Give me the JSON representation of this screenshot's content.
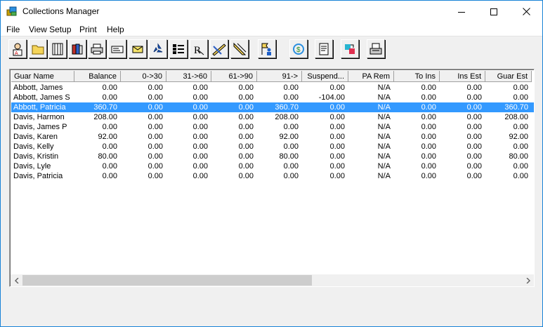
{
  "window": {
    "title": "Collections Manager"
  },
  "menu": [
    "File",
    "View Setup",
    "Print",
    "Help"
  ],
  "toolbar": {
    "icons": [
      "patient-icon",
      "folder-icon",
      "ledger-icon",
      "books-icon",
      "printer-icon",
      "card-icon",
      "envelope-icon",
      "recycle-icon",
      "list-view-icon",
      "prescription-icon",
      "pencil-ruler-icon",
      "ruler-icon",
      "person-flag-icon",
      "refresh-dollar-icon",
      "notes-icon",
      "transfer-icon",
      "printer-large-icon"
    ]
  },
  "grid": {
    "columns": [
      "Guar Name",
      "Balance",
      "0->30",
      "31->60",
      "61->90",
      "91->",
      "Suspend...",
      "PA Rem",
      "To Ins",
      "Ins Est",
      "Guar Est"
    ],
    "rows": [
      [
        "Abbott, James",
        "0.00",
        "0.00",
        "0.00",
        "0.00",
        "0.00",
        "0.00",
        "N/A",
        "0.00",
        "0.00",
        "0.00"
      ],
      [
        "Abbott, James S",
        "0.00",
        "0.00",
        "0.00",
        "0.00",
        "0.00",
        "-104.00",
        "N/A",
        "0.00",
        "0.00",
        "0.00"
      ],
      [
        "Abbott, Patricia",
        "360.70",
        "0.00",
        "0.00",
        "0.00",
        "360.70",
        "0.00",
        "N/A",
        "0.00",
        "0.00",
        "360.70"
      ],
      [
        "Davis, Harmon",
        "208.00",
        "0.00",
        "0.00",
        "0.00",
        "208.00",
        "0.00",
        "N/A",
        "0.00",
        "0.00",
        "208.00"
      ],
      [
        "Davis, James P",
        "0.00",
        "0.00",
        "0.00",
        "0.00",
        "0.00",
        "0.00",
        "N/A",
        "0.00",
        "0.00",
        "0.00"
      ],
      [
        "Davis, Karen",
        "92.00",
        "0.00",
        "0.00",
        "0.00",
        "92.00",
        "0.00",
        "N/A",
        "0.00",
        "0.00",
        "92.00"
      ],
      [
        "Davis, Kelly",
        "0.00",
        "0.00",
        "0.00",
        "0.00",
        "0.00",
        "0.00",
        "N/A",
        "0.00",
        "0.00",
        "0.00"
      ],
      [
        "Davis, Kristin",
        "80.00",
        "0.00",
        "0.00",
        "0.00",
        "80.00",
        "0.00",
        "N/A",
        "0.00",
        "0.00",
        "80.00"
      ],
      [
        "Davis, Lyle",
        "0.00",
        "0.00",
        "0.00",
        "0.00",
        "0.00",
        "0.00",
        "N/A",
        "0.00",
        "0.00",
        "0.00"
      ],
      [
        "Davis, Patricia",
        "0.00",
        "0.00",
        "0.00",
        "0.00",
        "0.00",
        "0.00",
        "N/A",
        "0.00",
        "0.00",
        "0.00"
      ]
    ],
    "selected_row": 2
  },
  "colors": {
    "selection": "#3399ff",
    "window_border": "#1883d7"
  }
}
